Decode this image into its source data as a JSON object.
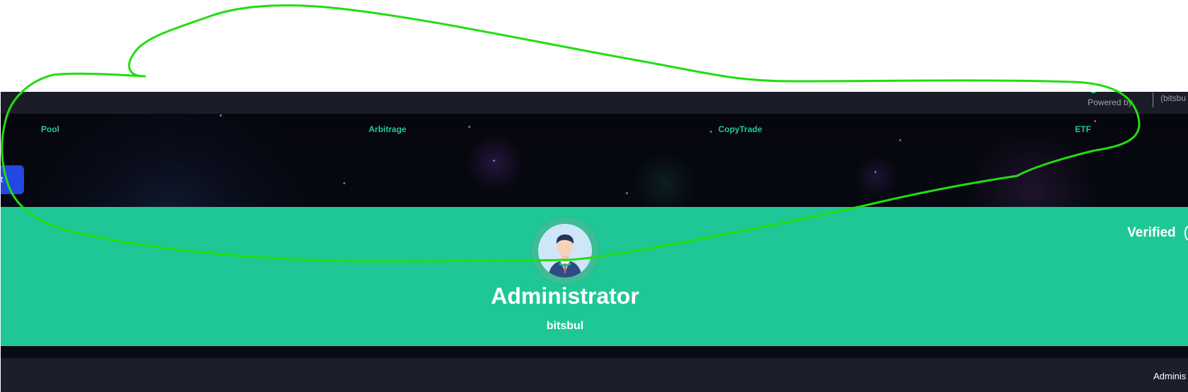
{
  "header": {
    "powered_by": "Powered by",
    "handle": "(bitsbu"
  },
  "nav": {
    "items": [
      "Pool",
      "Arbitrage",
      "CopyTrade",
      "ETF"
    ]
  },
  "side_button": {
    "label": "t"
  },
  "profile": {
    "name": "Administrator",
    "username": "bitsbul",
    "status": "Verified"
  },
  "footer": {
    "admin_label": "Adminis"
  },
  "icons": {
    "avatar": "user-avatar",
    "verified": "verified-badge-icon"
  },
  "colors": {
    "accent": "#20c796",
    "nav_text": "#23c895",
    "background": "#05060c",
    "button": "#2347e0",
    "annotation": "#22dd11"
  }
}
